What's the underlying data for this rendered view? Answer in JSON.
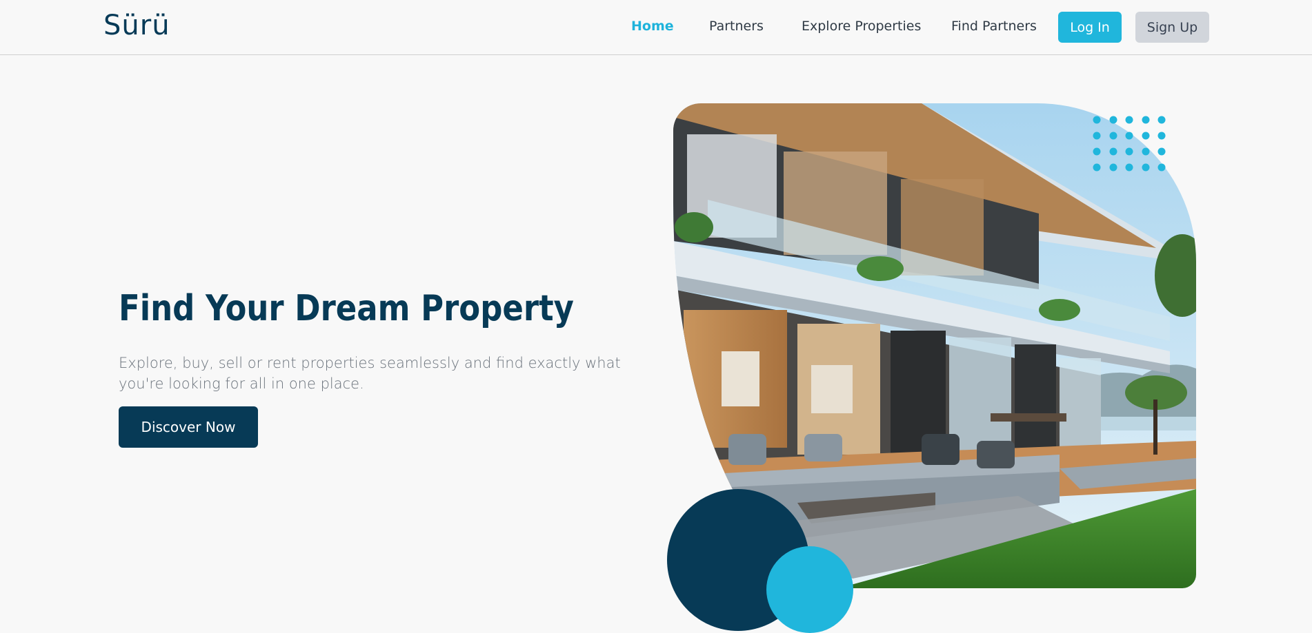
{
  "logo": "Sürü",
  "nav": {
    "home": "Home",
    "partners": "Partners",
    "explore": "Explore Properties",
    "find_partners": "Find Partners",
    "login": "Log In",
    "signup": "Sign Up"
  },
  "hero": {
    "title": "Find Your Dream Property",
    "description": "Explore, buy, sell or rent properties seamlessly and find exactly what you're looking for all in one place.",
    "cta": "Discover Now",
    "image_alt": "modern-house-with-patio"
  },
  "colors": {
    "primary_dark": "#073a56",
    "accent": "#20b6dc",
    "background": "#f8f8f8"
  }
}
